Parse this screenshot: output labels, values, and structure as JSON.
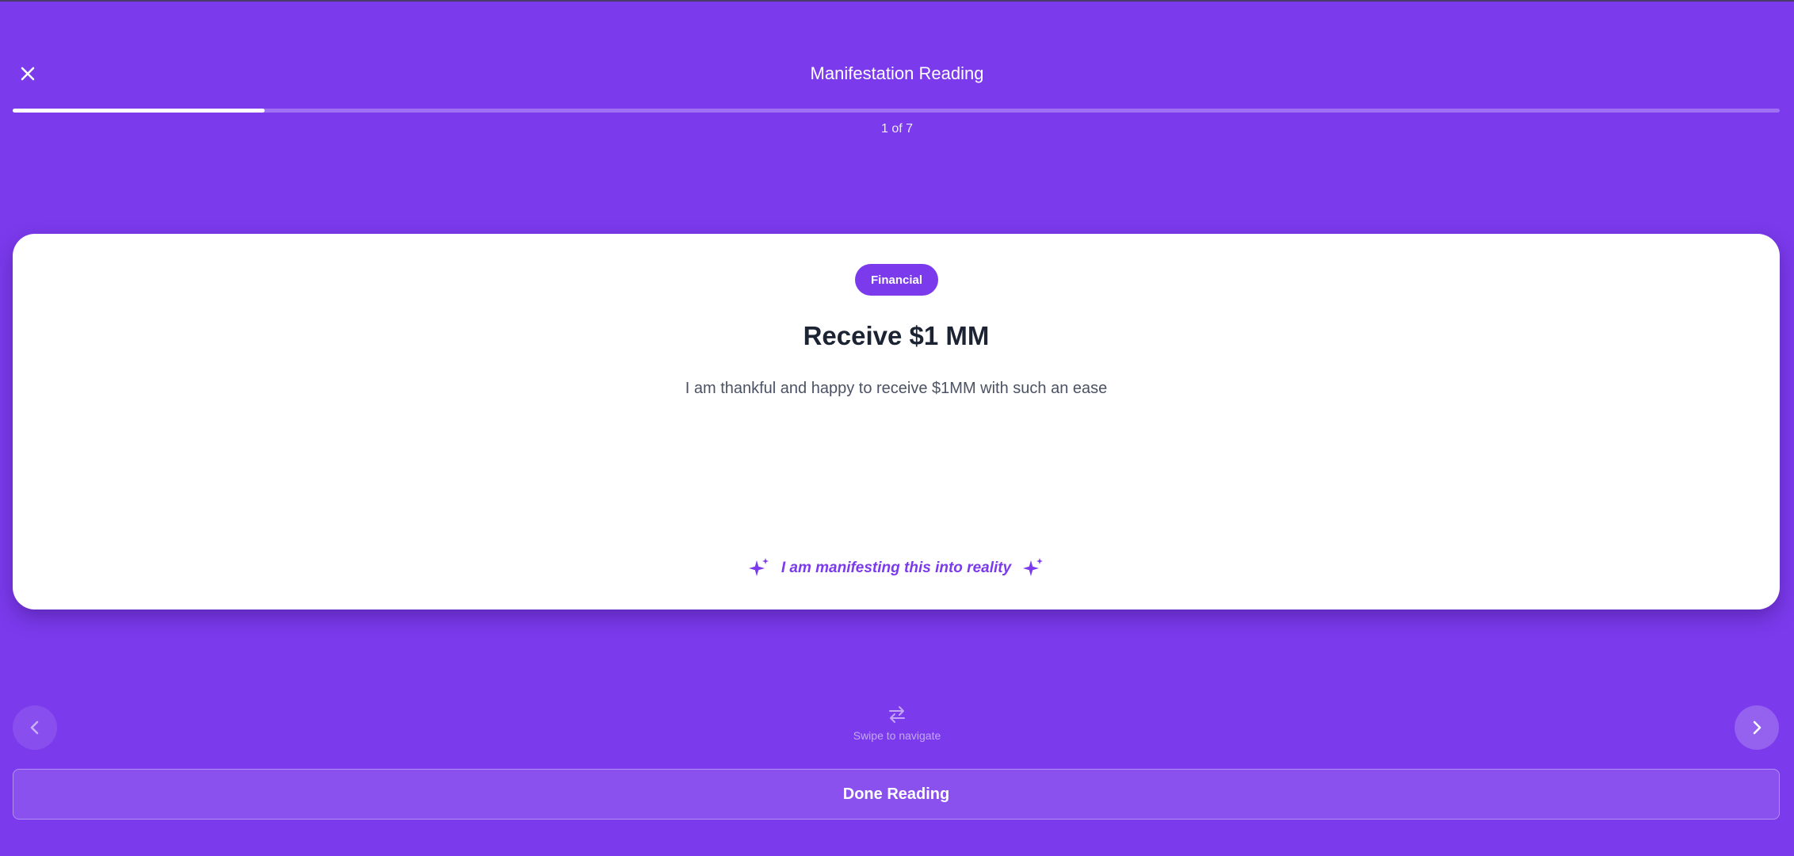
{
  "header": {
    "title": "Manifestation Reading",
    "close_icon": "close-icon",
    "progress_text": "1 of 7",
    "progress_fraction": 0.1428
  },
  "card": {
    "category": "Financial",
    "title": "Receive $1 MM",
    "description": "I am thankful and happy to receive $1MM with such an ease",
    "manifest_text": "I am manifesting this into reality",
    "sparkle_icon": "sparkles-icon"
  },
  "navigation": {
    "prev_icon": "chevron-left-icon",
    "next_icon": "chevron-right-icon",
    "swipe_icon": "swap-arrows-icon",
    "swipe_hint": "Swipe to navigate"
  },
  "footer": {
    "done_label": "Done Reading"
  },
  "colors": {
    "background": "#7b3aec",
    "accent": "#7b3aec",
    "card": "#ffffff",
    "title_text": "#1c2333"
  }
}
